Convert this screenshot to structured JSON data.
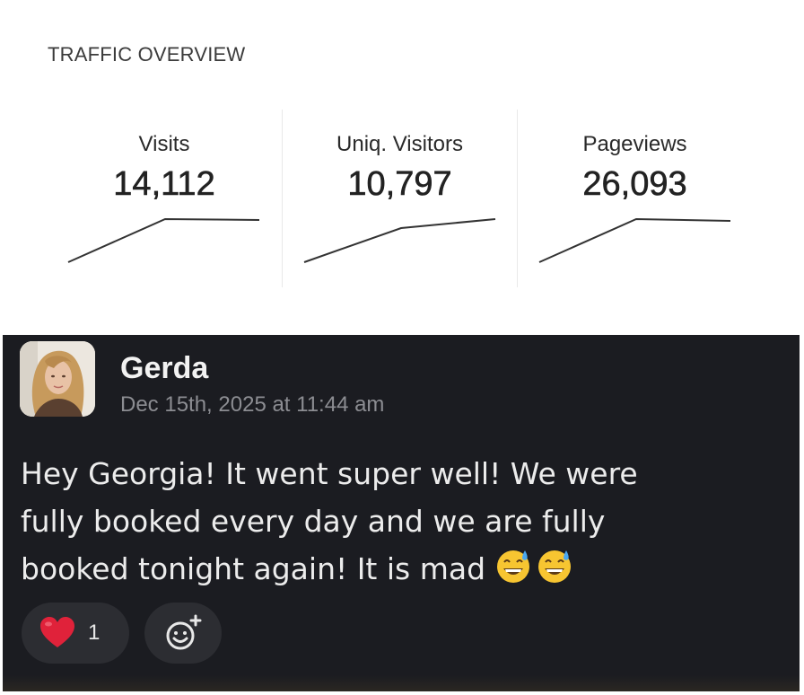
{
  "traffic": {
    "title": "TRAFFIC OVERVIEW",
    "stats": [
      {
        "label": "Visits",
        "value": "14,112"
      },
      {
        "label": "Uniq. Visitors",
        "value": "10,797"
      },
      {
        "label": "Pageviews",
        "value": "26,093"
      }
    ]
  },
  "message": {
    "author": "Gerda",
    "timestamp": "Dec 15th, 2025 at 11:44 am",
    "text_lines": [
      "Hey Georgia! It went super well! We were",
      "fully booked every day and we are fully",
      "booked tonight again! It is mad"
    ],
    "emojis": [
      "grinning-sweat-emoji",
      "grinning-sweat-emoji"
    ],
    "reactions": [
      {
        "icon": "red-heart-icon",
        "count": "1"
      }
    ],
    "add_reaction_icon": "add-emoji-icon",
    "colors": {
      "card_background": "#1b1c21",
      "reaction_pill": "#2c2d32",
      "heart": "#e0223a"
    }
  }
}
